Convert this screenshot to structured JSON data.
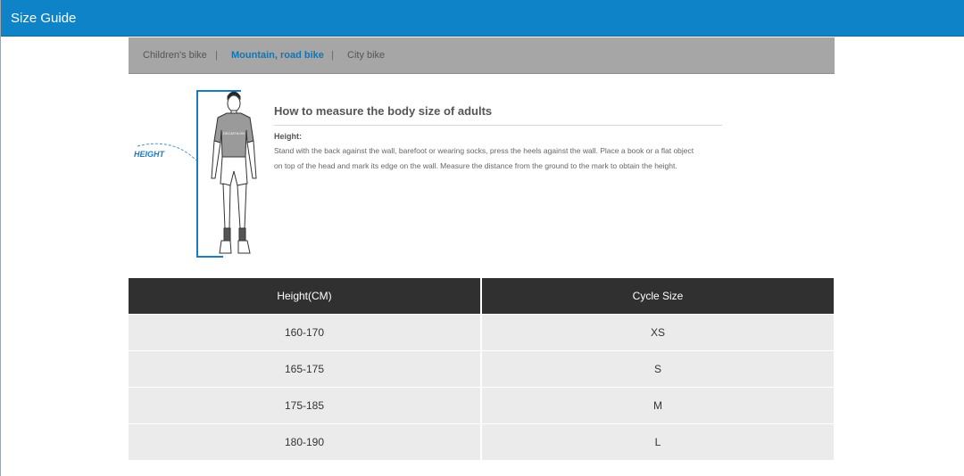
{
  "header": {
    "title": "Size Guide"
  },
  "tabs": [
    {
      "label": "Children's bike",
      "active": false
    },
    {
      "label": "Mountain, road bike",
      "active": true
    },
    {
      "label": "City bike",
      "active": false
    }
  ],
  "tab_separator": "|",
  "illustration": {
    "label": "HEIGHT",
    "shirt_text": "DECATHLON"
  },
  "info": {
    "title": "How to measure the body size of adults",
    "label": "Height:",
    "text_line1": "Stand with the back against the wall, barefoot or wearing socks, press the heels against the wall. Place a book or a flat object",
    "text_line2": "on top of the head and mark its edge on the wall. Measure the distance from the ground to the mark to obtain the height."
  },
  "table": {
    "headers": [
      "Height(CM)",
      "Cycle Size"
    ],
    "rows": [
      {
        "height": "160-170",
        "size": "XS"
      },
      {
        "height": "165-175",
        "size": "S"
      },
      {
        "height": "175-185",
        "size": "M"
      },
      {
        "height": "180-190",
        "size": "L"
      }
    ]
  },
  "colors": {
    "header_bg": "#0f83c7",
    "tabs_bg": "#a6a6a6",
    "active_tab": "#1475b3",
    "table_header_bg": "#303030",
    "table_row_bg": "#ebebeb",
    "measure_line": "#1a7bbf"
  }
}
